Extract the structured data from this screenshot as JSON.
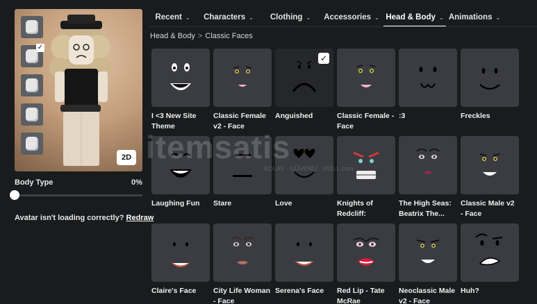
{
  "tabs": [
    {
      "label": "Recent",
      "active": false
    },
    {
      "label": "Characters",
      "active": false
    },
    {
      "label": "Clothing",
      "active": false
    },
    {
      "label": "Accessories",
      "active": false
    },
    {
      "label": "Head & Body",
      "active": true
    },
    {
      "label": "Animations",
      "active": false
    }
  ],
  "breadcrumb": {
    "parent": "Head & Body",
    "separator": ">",
    "current": "Classic Faces"
  },
  "avatar": {
    "view_button": "2D",
    "body_type_label": "Body Type",
    "body_type_value": "0%",
    "body_type_level": 0,
    "help_text": "Avatar isn't loading correctly?",
    "help_link": "Redraw",
    "thumbnails": [
      {
        "icon": "head-icon",
        "selected": false
      },
      {
        "icon": "head-icon",
        "selected": true
      },
      {
        "icon": "head-icon",
        "selected": false
      },
      {
        "icon": "head-icon",
        "selected": false
      },
      {
        "icon": "head-icon",
        "selected": false
      }
    ]
  },
  "items": [
    {
      "name": "I <3 New Site Theme",
      "selected": false
    },
    {
      "name": "Classic Female v2 - Face",
      "selected": false
    },
    {
      "name": "Anguished",
      "selected": true
    },
    {
      "name": "Classic Female - Face",
      "selected": false
    },
    {
      "name": ":3",
      "selected": false
    },
    {
      "name": "Freckles",
      "selected": false
    },
    {
      "name": "Laughing Fun",
      "selected": false
    },
    {
      "name": "Stare",
      "selected": false
    },
    {
      "name": "Love",
      "selected": false
    },
    {
      "name": "Knights of Redcliff: Paladi...",
      "selected": false
    },
    {
      "name": "The High Seas: Beatrix The...",
      "selected": false
    },
    {
      "name": "Classic Male v2 - Face",
      "selected": false
    },
    {
      "name": "Claire's Face",
      "selected": false
    },
    {
      "name": "City Life Woman - Face",
      "selected": false
    },
    {
      "name": "Serena's Face",
      "selected": false
    },
    {
      "name": "Red Lip - Tate McRae",
      "selected": false
    },
    {
      "name": "Neoclassic Male v2 - Face",
      "selected": false
    },
    {
      "name": "Huh?",
      "selected": false
    }
  ],
  "checkmark": "✓",
  "watermark": {
    "text": "itemsatis",
    "sub": "KOLAY · GÜVENLİ · HIZLI .com"
  }
}
